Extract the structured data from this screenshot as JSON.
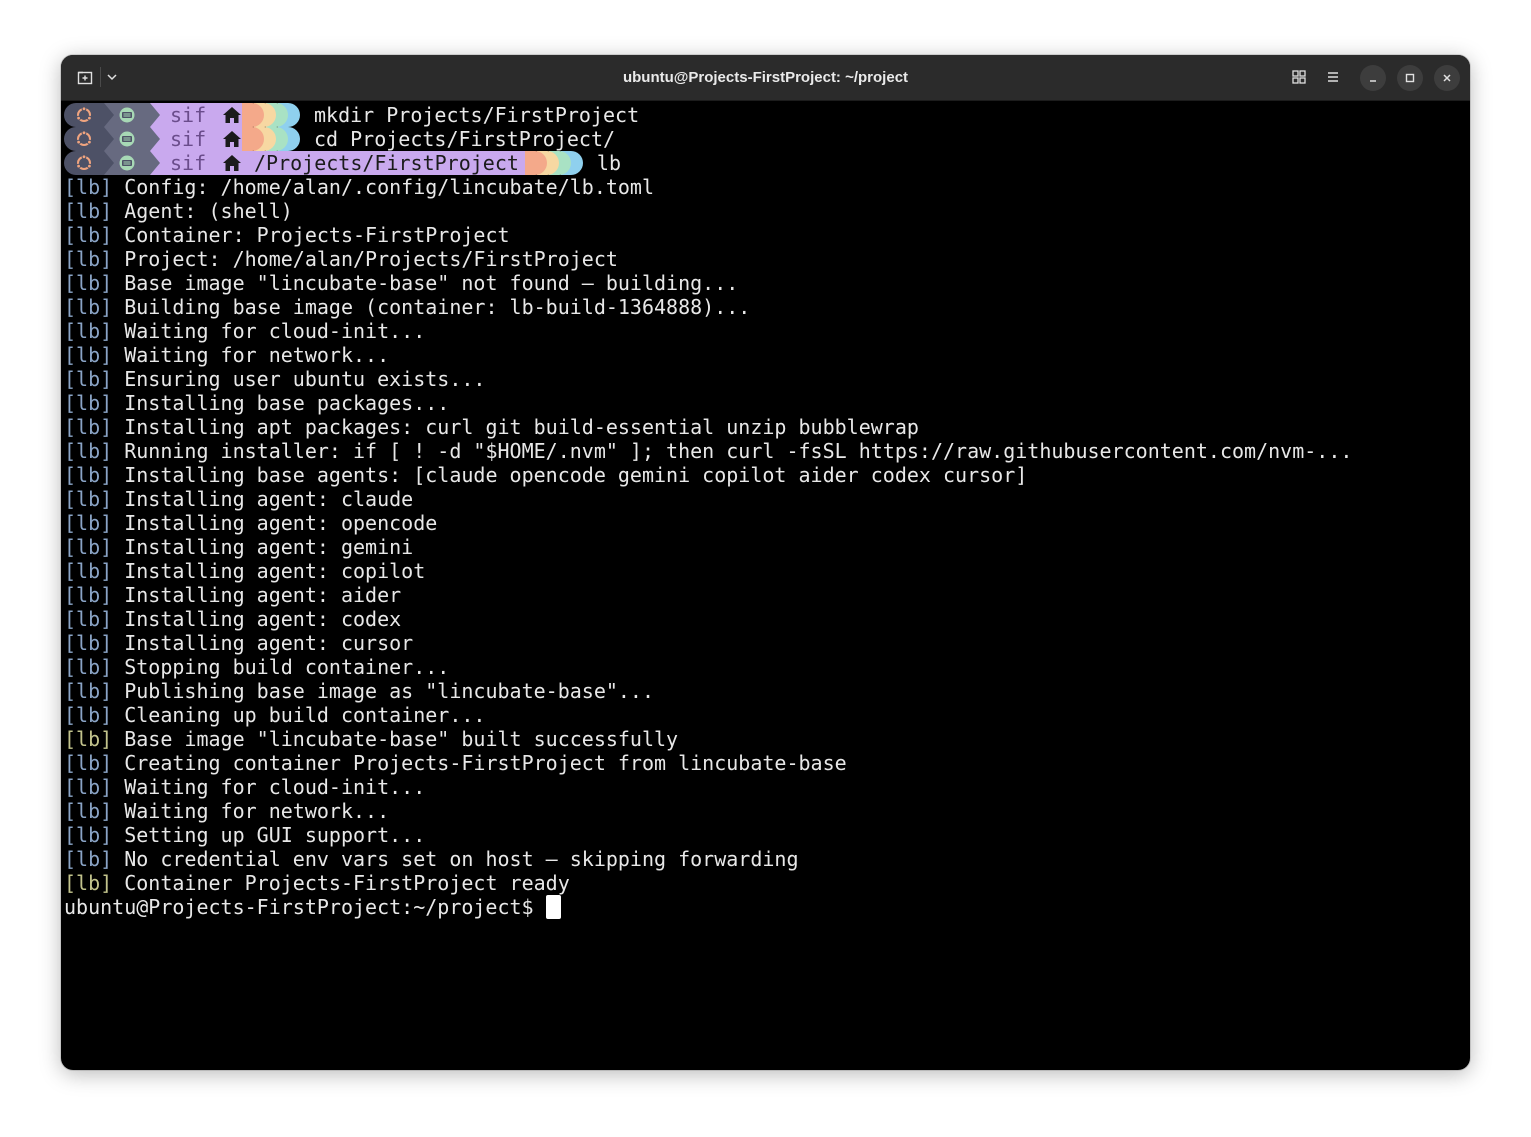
{
  "window": {
    "title": "ubuntu@Projects-FirstProject: ~/project"
  },
  "colors": {
    "prompt_os": "#4d5166",
    "prompt_shell": "#676a80",
    "prompt_user": "#c9a9ee",
    "pill_colors": [
      "#f4a98a",
      "#f7d8a2",
      "#a9e2c4",
      "#8fd0ee"
    ],
    "lb_tag": "#8aa4c6",
    "lb_tag_success": "#c2c38c"
  },
  "icons": {
    "new_tab": "new-tab-icon",
    "tab_menu": "chevron-down-icon",
    "overview": "grid-icon",
    "menu": "hamburger-menu-icon",
    "minimize": "minimize-icon",
    "maximize": "maximize-icon",
    "close": "close-icon",
    "prompt_os": "ubuntu-logo-icon",
    "prompt_shell": "shell-icon",
    "prompt_home": "home-icon"
  },
  "prompts": [
    {
      "user": "sif",
      "path": "",
      "command": "mkdir Projects/FirstProject"
    },
    {
      "user": "sif",
      "path": "",
      "command": "cd Projects/FirstProject/"
    },
    {
      "user": "sif",
      "path": "/Projects/FirstProject",
      "command": "lb"
    }
  ],
  "log": {
    "tag": "[lb]",
    "lines": [
      {
        "text": "Config: /home/alan/.config/lincubate/lb.toml",
        "status": "info"
      },
      {
        "text": "Agent: (shell)",
        "status": "info"
      },
      {
        "text": "Container: Projects-FirstProject",
        "status": "info"
      },
      {
        "text": "Project: /home/alan/Projects/FirstProject",
        "status": "info"
      },
      {
        "text": "Base image \"lincubate-base\" not found — building...",
        "status": "info"
      },
      {
        "text": "Building base image (container: lb-build-1364888)...",
        "status": "info"
      },
      {
        "text": "Waiting for cloud-init...",
        "status": "info"
      },
      {
        "text": "Waiting for network...",
        "status": "info"
      },
      {
        "text": "Ensuring user ubuntu exists...",
        "status": "info"
      },
      {
        "text": "Installing base packages...",
        "status": "info"
      },
      {
        "text": "Installing apt packages: curl git build-essential unzip bubblewrap",
        "status": "info"
      },
      {
        "text": "Running installer: if [ ! -d \"$HOME/.nvm\" ]; then curl -fsSL https://raw.githubusercontent.com/nvm-...",
        "status": "info"
      },
      {
        "text": "Installing base agents: [claude opencode gemini copilot aider codex cursor]",
        "status": "info"
      },
      {
        "text": "Installing agent: claude",
        "status": "info"
      },
      {
        "text": "Installing agent: opencode",
        "status": "info"
      },
      {
        "text": "Installing agent: gemini",
        "status": "info"
      },
      {
        "text": "Installing agent: copilot",
        "status": "info"
      },
      {
        "text": "Installing agent: aider",
        "status": "info"
      },
      {
        "text": "Installing agent: codex",
        "status": "info"
      },
      {
        "text": "Installing agent: cursor",
        "status": "info"
      },
      {
        "text": "Stopping build container...",
        "status": "info"
      },
      {
        "text": "Publishing base image as \"lincubate-base\"...",
        "status": "info"
      },
      {
        "text": "Cleaning up build container...",
        "status": "info"
      },
      {
        "text": "Base image \"lincubate-base\" built successfully",
        "status": "success"
      },
      {
        "text": "Creating container Projects-FirstProject from lincubate-base",
        "status": "info"
      },
      {
        "text": "Waiting for cloud-init...",
        "status": "info"
      },
      {
        "text": "Waiting for network...",
        "status": "info"
      },
      {
        "text": "Setting up GUI support...",
        "status": "info"
      },
      {
        "text": "No credential env vars set on host — skipping forwarding",
        "status": "info"
      },
      {
        "text": "Container Projects-FirstProject ready",
        "status": "success"
      }
    ]
  },
  "final_prompt": "ubuntu@Projects-FirstProject:~/project$ "
}
